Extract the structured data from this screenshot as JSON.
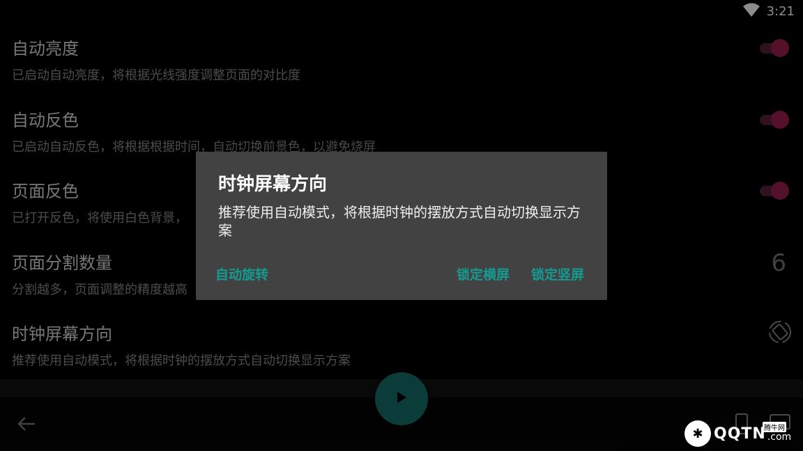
{
  "status": {
    "time": "3:21",
    "wifi_icon": "wifi-icon"
  },
  "settings": [
    {
      "title": "自动亮度",
      "desc": "已启动自动亮度，将根据光线强度调整页面的对比度",
      "control": "switch",
      "on": true
    },
    {
      "title": "自动反色",
      "desc": "已启动自动反色，将根据根据时间，自动切换前景色，以避免烧屏",
      "control": "switch",
      "on": true
    },
    {
      "title": "页面反色",
      "desc": "已打开反色，将使用白色背景，",
      "control": "switch",
      "on": true
    },
    {
      "title": "页面分割数量",
      "desc": "分割越多，页面调整的精度越高",
      "control": "value",
      "value": "6"
    },
    {
      "title": "时钟屏幕方向",
      "desc": "推荐使用自动模式，将根据时钟的摆放方式自动切换显示方案",
      "control": "icon",
      "icon": "screen-rotation-icon"
    }
  ],
  "dialog": {
    "title": "时钟屏幕方向",
    "message": "推荐使用自动模式，将根据时钟的摆放方式自动切换显示方案",
    "buttons": {
      "auto": "自动旋转",
      "landscape": "锁定横屏",
      "portrait": "锁定竖屏"
    }
  },
  "watermark": {
    "brand": "QQTN",
    "suffix": ".com",
    "tag": "腾牛网"
  },
  "colors": {
    "accent": "#159a90",
    "switch_thumb": "#9c1f4b",
    "fab": "#146e6b",
    "dialog_bg": "#424242"
  }
}
